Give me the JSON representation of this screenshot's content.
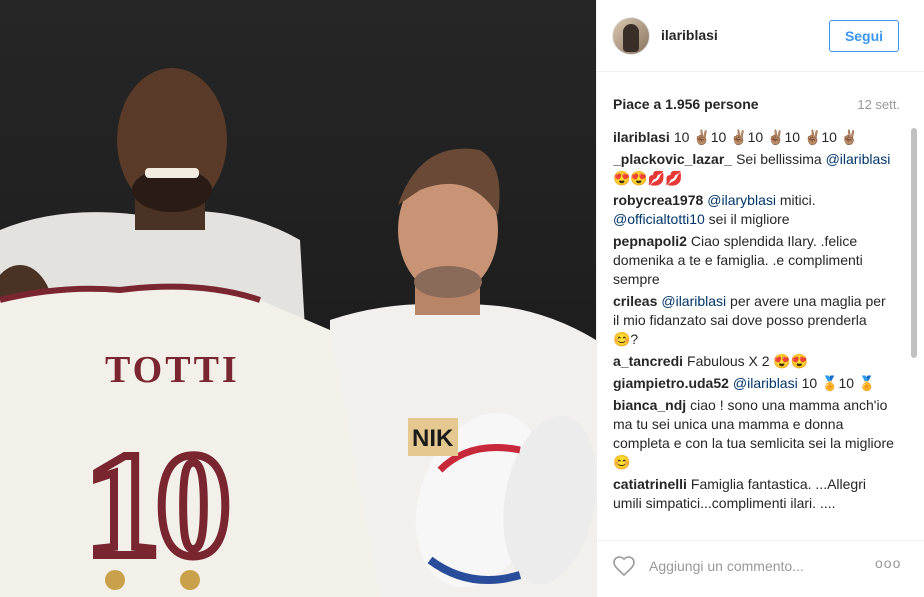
{
  "post": {
    "username": "ilariblasi",
    "follow_label": "Segui",
    "likes": "Piace a 1.956 persone",
    "time": "12 sett.",
    "photo_text": {
      "jersey_name": "TOTTI",
      "jersey_number": "10",
      "shoe_brand": "NIK"
    }
  },
  "comments": [
    {
      "user": "ilariblasi",
      "parts": [
        {
          "t": "10 ✌🏽10 ✌🏽10 ✌🏽10 ✌🏽10 ✌🏽",
          "m": false
        }
      ]
    },
    {
      "user": "_plackovic_lazar_",
      "parts": [
        {
          "t": "Sei bellissima ",
          "m": false
        },
        {
          "t": "@ilariblasi",
          "m": true
        },
        {
          "t": " 😍😍💋💋",
          "m": false
        }
      ]
    },
    {
      "user": "robycrea1978",
      "parts": [
        {
          "t": "@ilaryblasi",
          "m": true
        },
        {
          "t": " mitici. ",
          "m": false
        },
        {
          "t": "@officialtotti10",
          "m": true
        },
        {
          "t": " sei il migliore",
          "m": false
        }
      ]
    },
    {
      "user": "pepnapoli2",
      "parts": [
        {
          "t": "Ciao splendida Ilary. .felice domenika a te e famiglia. .e complimenti sempre",
          "m": false
        }
      ]
    },
    {
      "user": "crileas",
      "parts": [
        {
          "t": "@ilariblasi",
          "m": true
        },
        {
          "t": " per avere una maglia per il mio fidanzato sai dove posso prenderla 😊?",
          "m": false
        }
      ]
    },
    {
      "user": "a_tancredi",
      "parts": [
        {
          "t": "Fabulous X 2 😍😍",
          "m": false
        }
      ]
    },
    {
      "user": "giampietro.uda52",
      "parts": [
        {
          "t": "@ilariblasi",
          "m": true
        },
        {
          "t": " 10 🏅10 🏅",
          "m": false
        }
      ]
    },
    {
      "user": "bianca_ndj",
      "parts": [
        {
          "t": "ciao ! sono una mamma anch'io ma tu sei unica una mamma e donna completa e con la tua semlicita sei la migliore 😊",
          "m": false
        }
      ]
    },
    {
      "user": "catiatrinelli",
      "parts": [
        {
          "t": "Famiglia fantastica. ...Allegri umili simpatici...complimenti ilari. ....",
          "m": false
        }
      ]
    }
  ],
  "add_comment": {
    "placeholder": "Aggiungi un commento...",
    "more_label": "ooo"
  },
  "icons": {
    "heart": "heart-icon",
    "more": "more-options-icon",
    "avatar": "avatar"
  },
  "colors": {
    "accent": "#3897f0",
    "mention": "#003569",
    "muted": "#999999"
  }
}
